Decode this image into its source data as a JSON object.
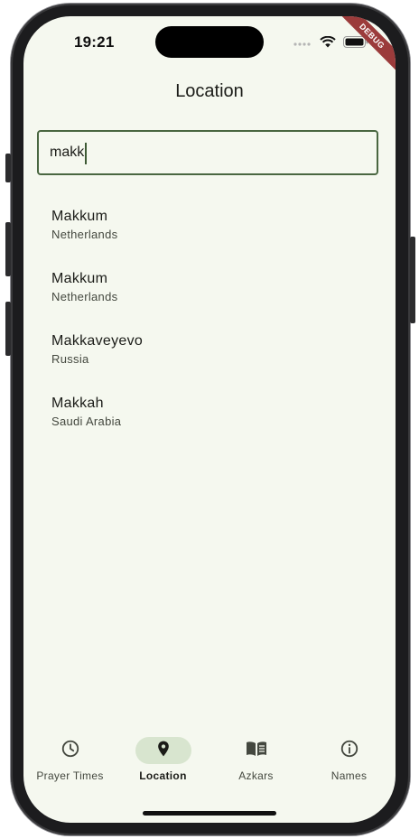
{
  "status_bar": {
    "time": "19:21",
    "debug_label": "DEBUG"
  },
  "page": {
    "title": "Location"
  },
  "search": {
    "value": "makk",
    "placeholder": ""
  },
  "results": [
    {
      "city": "Makkum",
      "country": "Netherlands"
    },
    {
      "city": "Makkum",
      "country": "Netherlands"
    },
    {
      "city": "Makkaveyevo",
      "country": "Russia"
    },
    {
      "city": "Makkah",
      "country": "Saudi Arabia"
    }
  ],
  "nav": {
    "items": [
      {
        "label": "Prayer Times",
        "icon": "clock-icon",
        "active": false
      },
      {
        "label": "Location",
        "icon": "location-pin-icon",
        "active": true
      },
      {
        "label": "Azkars",
        "icon": "book-icon",
        "active": false
      },
      {
        "label": "Names",
        "icon": "info-icon",
        "active": false
      }
    ]
  },
  "colors": {
    "background": "#f5f8ef",
    "accent": "#4a6741",
    "active_pill": "#d8e5cf",
    "debug_ribbon": "#9b3b3b"
  }
}
